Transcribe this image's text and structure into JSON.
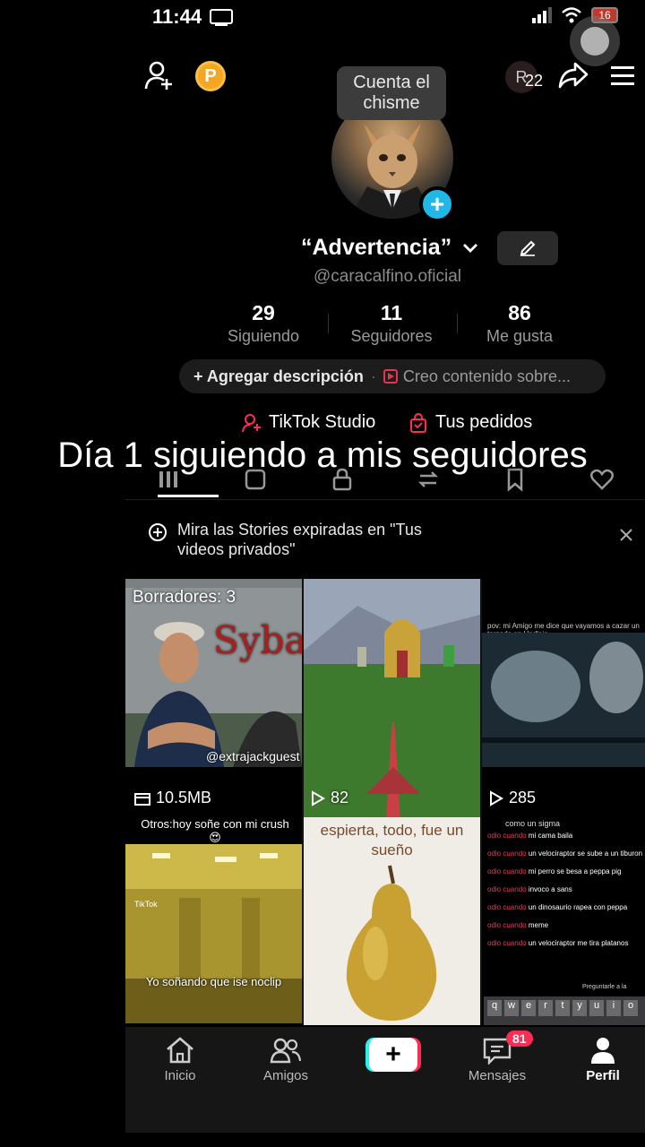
{
  "status": {
    "time": "11:44",
    "battery": "16"
  },
  "top": {
    "coin_letter": "P",
    "mini_avatar_letter": "R",
    "mini_count": "22"
  },
  "profile": {
    "tooltip": "Cuenta el chisme",
    "display_name": "“Advertencia”",
    "handle": "@caracalfino.oficial",
    "stats": [
      {
        "value": "29",
        "label": "Siguiendo"
      },
      {
        "value": "11",
        "label": "Seguidores"
      },
      {
        "value": "86",
        "label": "Me gusta"
      }
    ],
    "add_description": "+ Agregar descripción",
    "content_about": "Creo contenido sobre...",
    "studio": "TikTok Studio",
    "orders": "Tus pedidos"
  },
  "overlay_caption": "Día 1 siguiendo a mis seguidores",
  "banner": {
    "text": "Mira las Stories expiradas en \"Tus videos privados\""
  },
  "grid": {
    "cells": [
      {
        "top_label": "Borradores: 3",
        "image_text": "Syba",
        "handle": "@extrajackguest",
        "bottom_label": "10.5MB"
      },
      {
        "bottom_label": "82"
      },
      {
        "small_text": "pov: mi Amigo me dice que vayamos a cazar un tornado en Hadleig",
        "bottom_label": "285"
      },
      {
        "top_text": "Otros:hoy soñe con mi crush 😍",
        "image_text": "Yo soñando que ise noclip",
        "tiktok": "TikTok"
      },
      {
        "top_text": "espierta, todo, fue un sueño"
      },
      {
        "top_text": "como un sigma",
        "comments": [
          {
            "prefix": "odio cuando",
            "text": "mi cama baila"
          },
          {
            "prefix": "odio cuando",
            "text": "un velociraptor se sube a un tiburon"
          },
          {
            "prefix": "odio cuando",
            "text": "mi perro se besa a peppa pig"
          },
          {
            "prefix": "odio cuando",
            "text": "invoco a sans"
          },
          {
            "prefix": "odio cuando",
            "text": "un dinosaurio rapea con peppa"
          },
          {
            "prefix": "odio cuando",
            "text": "meme"
          },
          {
            "prefix": "odio cuando",
            "text": "un velociraptor me tira platanos"
          }
        ],
        "ask": "Preguntarle a la",
        "keys": [
          "q",
          "w",
          "e",
          "r",
          "t",
          "y",
          "u",
          "i",
          "o"
        ]
      }
    ]
  },
  "nav": {
    "items": [
      {
        "label": "Inicio"
      },
      {
        "label": "Amigos"
      },
      {
        "label": "+"
      },
      {
        "label": "Mensajes"
      },
      {
        "label": "Perfil"
      }
    ],
    "messages_badge": "81"
  },
  "colors": {
    "accent": "#fe2c55",
    "cyan": "#21b8e8",
    "coin": "#f5a623"
  }
}
